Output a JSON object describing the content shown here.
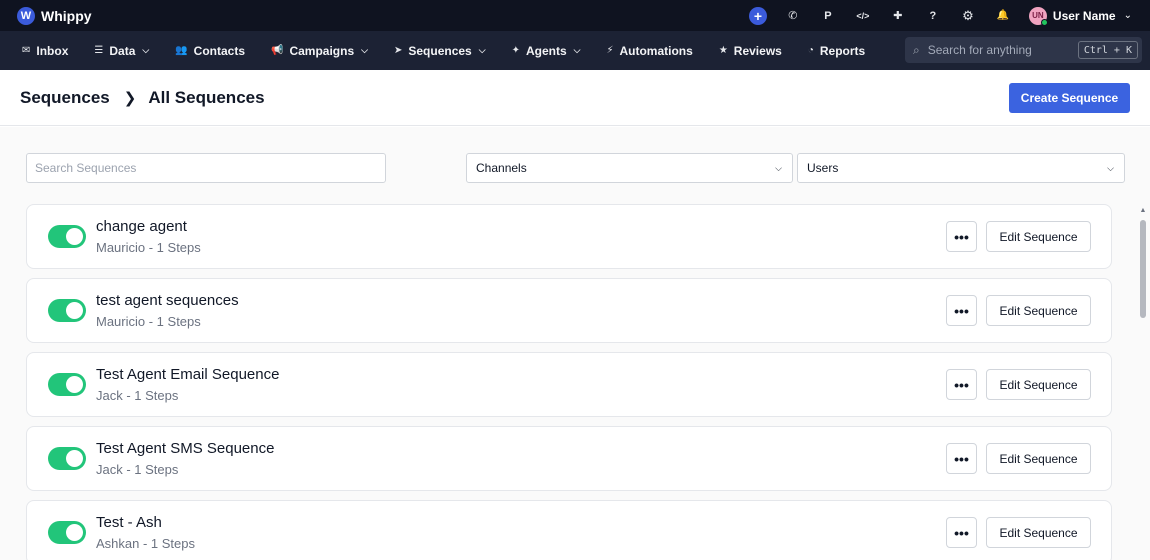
{
  "app": {
    "name": "Whippy",
    "logo_letter": "W"
  },
  "topbar": {
    "icons": [
      {
        "name": "plus-icon",
        "glyph": "+"
      },
      {
        "name": "phone-icon",
        "glyph": "✆"
      },
      {
        "name": "p-icon",
        "glyph": "P"
      },
      {
        "name": "code-icon",
        "glyph": "</>"
      },
      {
        "name": "puzzle-icon",
        "glyph": "✚"
      },
      {
        "name": "help-icon",
        "glyph": "?"
      },
      {
        "name": "gear-icon",
        "glyph": "⚙"
      },
      {
        "name": "bell-icon",
        "glyph": "🔔"
      }
    ],
    "user": {
      "initials": "UN",
      "name": "User Name"
    }
  },
  "nav": {
    "items": [
      {
        "label": "Inbox",
        "icon": "inbox-icon",
        "has_dropdown": false
      },
      {
        "label": "Data",
        "icon": "database-icon",
        "has_dropdown": true
      },
      {
        "label": "Contacts",
        "icon": "contacts-icon",
        "has_dropdown": false
      },
      {
        "label": "Campaigns",
        "icon": "megaphone-icon",
        "has_dropdown": true
      },
      {
        "label": "Sequences",
        "icon": "send-icon",
        "has_dropdown": true
      },
      {
        "label": "Agents",
        "icon": "sparkle-icon",
        "has_dropdown": true
      },
      {
        "label": "Automations",
        "icon": "bolt-icon",
        "has_dropdown": false
      },
      {
        "label": "Reviews",
        "icon": "star-icon",
        "has_dropdown": false
      },
      {
        "label": "Reports",
        "icon": "pie-icon",
        "has_dropdown": false
      }
    ],
    "search": {
      "placeholder": "Search for anything",
      "shortcut": "Ctrl + K"
    }
  },
  "header": {
    "breadcrumb": [
      "Sequences",
      "All Sequences"
    ],
    "create_label": "Create Sequence"
  },
  "filters": {
    "search_placeholder": "Search Sequences",
    "search_value": "",
    "channels_label": "Channels",
    "users_label": "Users"
  },
  "sequences": [
    {
      "title": "change agent",
      "subtitle": "Mauricio - 1 Steps",
      "enabled": true
    },
    {
      "title": "test agent sequences",
      "subtitle": "Mauricio - 1 Steps",
      "enabled": true
    },
    {
      "title": "Test Agent Email Sequence",
      "subtitle": "Jack  - 1 Steps",
      "enabled": true
    },
    {
      "title": "Test Agent SMS Sequence",
      "subtitle": "Jack  - 1 Steps",
      "enabled": true
    },
    {
      "title": "Test - Ash",
      "subtitle": "Ashkan  - 1 Steps",
      "enabled": true
    }
  ],
  "row_actions": {
    "more_label": "•••",
    "edit_label": "Edit Sequence"
  },
  "colors": {
    "topbar": "#0f1320",
    "navbar": "#1c2234",
    "accent": "#3b63e0",
    "toggle_on": "#22c57a"
  }
}
